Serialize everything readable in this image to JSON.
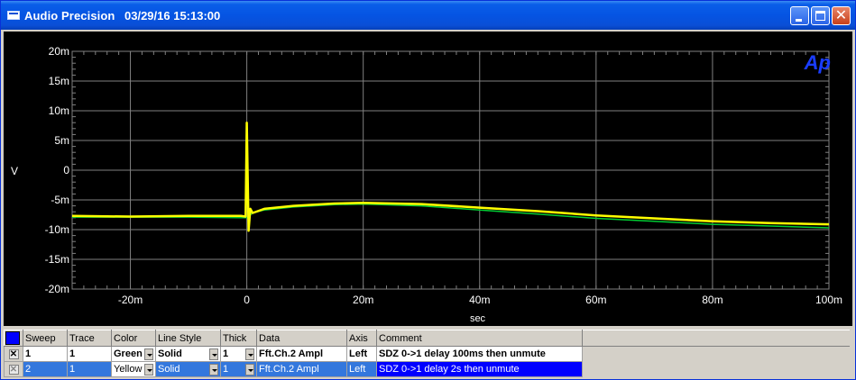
{
  "window": {
    "app_title": "Audio Precision",
    "datetime": "03/29/16 15:13:00",
    "min_icon": "minimize-icon",
    "max_icon": "maximize-icon",
    "close_icon": "close-icon",
    "close_glyph": "✕"
  },
  "logo": {
    "text": "Ap",
    "color": "#1a3dff"
  },
  "chart_data": {
    "type": "line",
    "ylabel": "V",
    "xlabel": "sec",
    "x_range": [
      -0.03,
      0.1
    ],
    "y_range": [
      -0.02,
      0.02
    ],
    "x_ticks": [
      {
        "v": -0.02,
        "label": "-20m"
      },
      {
        "v": 0,
        "label": "0"
      },
      {
        "v": 0.02,
        "label": "20m"
      },
      {
        "v": 0.04,
        "label": "40m"
      },
      {
        "v": 0.06,
        "label": "60m"
      },
      {
        "v": 0.08,
        "label": "80m"
      },
      {
        "v": 0.1,
        "label": "100m"
      }
    ],
    "y_ticks": [
      {
        "v": 0.02,
        "label": "20m"
      },
      {
        "v": 0.015,
        "label": "15m"
      },
      {
        "v": 0.01,
        "label": "10m"
      },
      {
        "v": 0.005,
        "label": "5m"
      },
      {
        "v": 0,
        "label": "0"
      },
      {
        "v": -0.005,
        "label": "-5m"
      },
      {
        "v": -0.01,
        "label": "-10m"
      },
      {
        "v": -0.015,
        "label": "-15m"
      },
      {
        "v": -0.02,
        "label": "-20m"
      }
    ],
    "grid": true,
    "series": [
      {
        "name": "Fft.Ch.2 Ampl",
        "color": "#00cc33",
        "points": [
          [
            -0.03,
            -0.0079
          ],
          [
            -0.02,
            -0.0079
          ],
          [
            -0.01,
            -0.0079
          ],
          [
            -0.001,
            -0.008
          ],
          [
            0,
            -0.008
          ],
          [
            0.001,
            -0.0072
          ],
          [
            0.003,
            -0.0067
          ],
          [
            0.008,
            -0.0062
          ],
          [
            0.015,
            -0.0058
          ],
          [
            0.02,
            -0.0057
          ],
          [
            0.03,
            -0.006
          ],
          [
            0.04,
            -0.0067
          ],
          [
            0.05,
            -0.0074
          ],
          [
            0.06,
            -0.0081
          ],
          [
            0.07,
            -0.0086
          ],
          [
            0.08,
            -0.0091
          ],
          [
            0.09,
            -0.0094
          ],
          [
            0.1,
            -0.0097
          ]
        ]
      },
      {
        "name": "Fft.Ch.2 Ampl",
        "color": "#ffff00",
        "points": [
          [
            -0.03,
            -0.0077
          ],
          [
            -0.02,
            -0.0078
          ],
          [
            -0.01,
            -0.0077
          ],
          [
            -0.001,
            -0.0077
          ],
          [
            -0.0002,
            -0.0078
          ],
          [
            0,
            0.008
          ],
          [
            0.0003,
            -0.0102
          ],
          [
            0.0006,
            -0.0065
          ],
          [
            0.001,
            -0.0072
          ],
          [
            0.003,
            -0.0065
          ],
          [
            0.008,
            -0.006
          ],
          [
            0.015,
            -0.0056
          ],
          [
            0.02,
            -0.0055
          ],
          [
            0.03,
            -0.0057
          ],
          [
            0.04,
            -0.0063
          ],
          [
            0.05,
            -0.0069
          ],
          [
            0.06,
            -0.0076
          ],
          [
            0.07,
            -0.0081
          ],
          [
            0.08,
            -0.0086
          ],
          [
            0.09,
            -0.0089
          ],
          [
            0.1,
            -0.0091
          ]
        ]
      }
    ]
  },
  "legend": {
    "headers": [
      "Sweep",
      "Trace",
      "Color",
      "Line Style",
      "Thick",
      "Data",
      "Axis",
      "Comment"
    ],
    "rows": [
      {
        "check": "✕",
        "sweep": "1",
        "trace": "1",
        "color": "Green",
        "line_style": "Solid",
        "thick": "1",
        "data": "Fft.Ch.2 Ampl",
        "axis": "Left",
        "comment": "SDZ 0->1  delay 100ms then unmute"
      },
      {
        "check": "✕",
        "sweep": "2",
        "trace": "1",
        "color": "Yellow",
        "line_style": "Solid",
        "thick": "1",
        "data": "Fft.Ch.2 Ampl",
        "axis": "Left",
        "comment": "SDZ 0->1  delay  2s then unmute"
      }
    ]
  }
}
